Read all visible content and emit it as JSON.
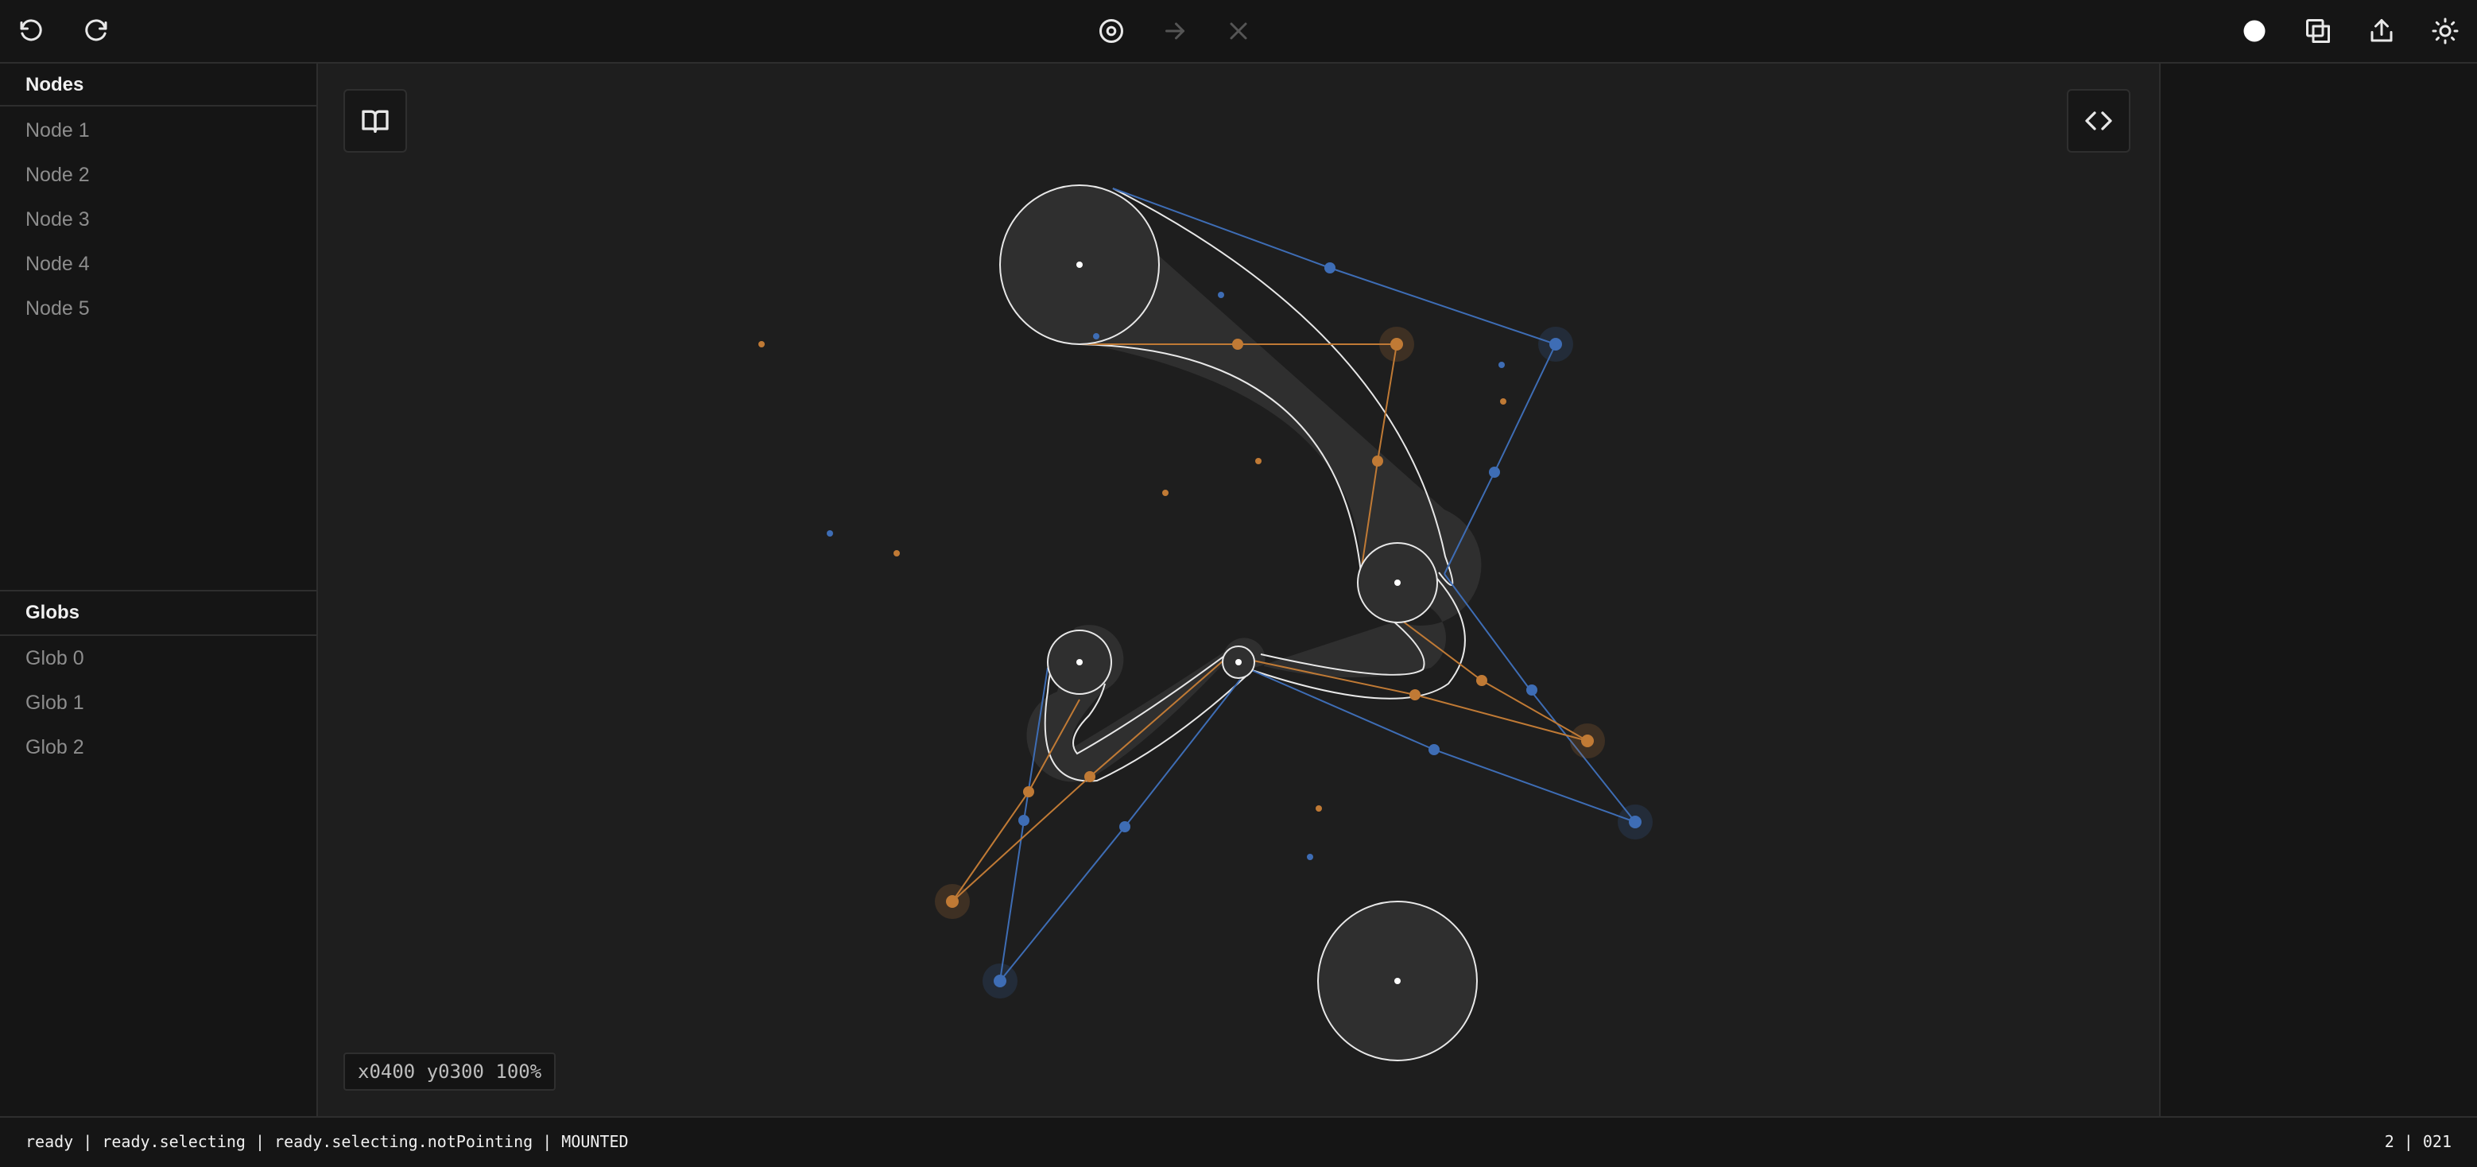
{
  "toolbar": {
    "undo_icon": "undo-icon",
    "redo_icon": "redo-icon",
    "center_icon": "target-icon",
    "arrow_icon": "arrow-right-icon",
    "close_icon": "close-icon",
    "fill_icon": "filled-circle-icon",
    "copy_icon": "copy-icon",
    "share_icon": "share-icon",
    "theme_icon": "sun-icon"
  },
  "sidebar": {
    "nodes_title": "Nodes",
    "nodes": [
      "Node 1",
      "Node 2",
      "Node 3",
      "Node 4",
      "Node 5"
    ],
    "globs_title": "Globs",
    "globs": [
      "Glob 0",
      "Glob 1",
      "Glob 2"
    ]
  },
  "canvas": {
    "book_icon": "book-icon",
    "code_icon": "code-icon",
    "coords": "x0400 y0300 100%"
  },
  "status": {
    "states": "ready | ready.selecting | ready.selecting.notPointing | MOUNTED",
    "counts": "2 | 021"
  },
  "colors": {
    "background": "#1e1e1e",
    "panel": "#151515",
    "blue": "#3e6db5",
    "orange": "#c07a35",
    "node_fill": "#2f2f2f",
    "stroke": "#e8e8e8"
  }
}
